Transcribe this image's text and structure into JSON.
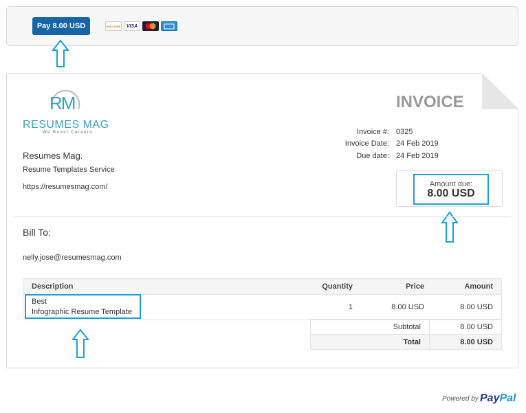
{
  "pay_button_label": "Pay 8.00 USD",
  "cards": [
    {
      "name": "discover-card-icon",
      "text": "DISCOVER",
      "bg": "#ffffff",
      "fg": "#e07a16"
    },
    {
      "name": "visa-card-icon",
      "text": "VISA",
      "bg": "#ffffff",
      "fg": "#1a1f71"
    },
    {
      "name": "mastercard-card-icon",
      "text": "",
      "bg": "#1d1d3a",
      "fg": "#ffffff"
    },
    {
      "name": "amex-card-icon",
      "text": "",
      "bg": "#2e8fd1",
      "fg": "#ffffff"
    }
  ],
  "logo": {
    "monogram": "RM",
    "name": "RESUMES MAG",
    "tagline": "We Boost Careers",
    "color": "#3aa0b8"
  },
  "company": {
    "name": "Resumes Mag.",
    "service": "Resume Templates Service",
    "url": "https://resumesmag.com/"
  },
  "invoice_title": "INVOICE",
  "meta": {
    "number_label": "Invoice #:",
    "number": "0325",
    "date_label": "Invoice Date:",
    "date": "24 Feb 2019",
    "due_label": "Due date:",
    "due": "24 Feb 2019"
  },
  "amount_due": {
    "label": "Amount due:",
    "value": "8.00 USD"
  },
  "bill_to": {
    "label": "Bill To:",
    "email": "nelly.jose@resumesmag.com"
  },
  "columns": {
    "description": "Description",
    "quantity": "Quantity",
    "price": "Price",
    "amount": "Amount"
  },
  "items": [
    {
      "desc_line1": "Best",
      "desc_line2": "Infographic Resume Template",
      "quantity": "1",
      "price": "8.00 USD",
      "amount": "8.00 USD"
    }
  ],
  "subtotal": {
    "label": "Subtotal",
    "value": "8.00 USD"
  },
  "total": {
    "label": "Total",
    "value": "8.00 USD"
  },
  "footer": {
    "powered_by": "Powered by",
    "brand_pay": "Pay",
    "brand_pal": "Pal"
  },
  "colors": {
    "accent": "#1a9fd6",
    "button": "#1565a8",
    "invoice_title": "#999999"
  }
}
